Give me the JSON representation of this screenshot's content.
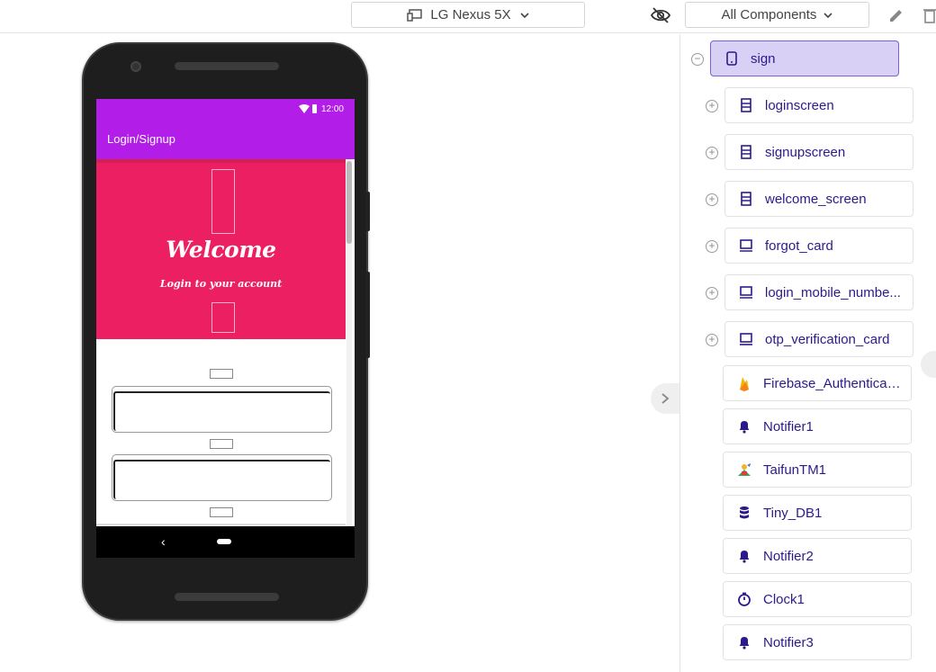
{
  "toolbar": {
    "device_label": "LG Nexus 5X",
    "components_label": "All Components"
  },
  "phone": {
    "status_time": "12:00",
    "app_title": "Login/Signup",
    "welcome_text": "Welcome",
    "subtitle_text": "Login to your account",
    "nav_back": "‹"
  },
  "tree": {
    "root": {
      "label": "sign",
      "icon": "phone-icon"
    },
    "items": [
      {
        "label": "loginscreen",
        "icon": "vertical-arrangement-icon"
      },
      {
        "label": "signupscreen",
        "icon": "vertical-arrangement-icon"
      },
      {
        "label": "welcome_screen",
        "icon": "vertical-arrangement-icon"
      },
      {
        "label": "forgot_card",
        "icon": "card-icon"
      },
      {
        "label": "login_mobile_numbe...",
        "icon": "card-icon"
      },
      {
        "label": "otp_verification_card",
        "icon": "card-icon"
      },
      {
        "label": "Firebase_Authenticati...",
        "icon": "firebase-icon"
      },
      {
        "label": "Notifier1",
        "icon": "bell-icon"
      },
      {
        "label": "TaifunTM1",
        "icon": "extension-icon"
      },
      {
        "label": "Tiny_DB1",
        "icon": "database-icon"
      },
      {
        "label": "Notifier2",
        "icon": "bell-icon"
      },
      {
        "label": "Clock1",
        "icon": "timer-icon"
      },
      {
        "label": "Notifier3",
        "icon": "bell-icon"
      }
    ]
  },
  "colors": {
    "appbar": "#b31de8",
    "header": "#ec1f62",
    "tree_text": "#2c1a8b",
    "tree_selected": "#d8d0f5"
  }
}
